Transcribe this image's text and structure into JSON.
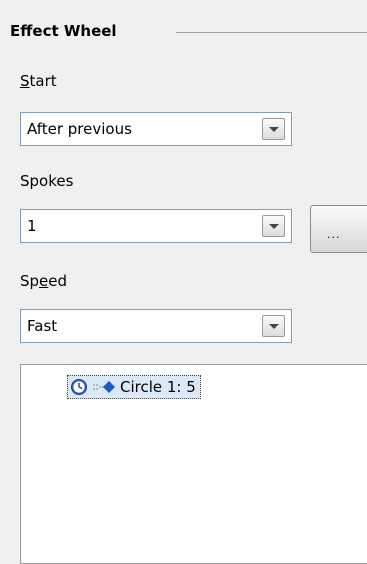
{
  "section": {
    "title": "Effect Wheel"
  },
  "start": {
    "label_mnemonic": "S",
    "label_rest": "tart",
    "value": "After previous"
  },
  "spokes": {
    "label": "Spokes",
    "value": "1",
    "more_button_label": "..."
  },
  "speed": {
    "label_before": "Sp",
    "label_mnemonic": "e",
    "label_after": "ed",
    "value": "Fast"
  },
  "effects": [
    {
      "trigger_icon": "clock-icon",
      "type_icon": "effect-entrance-icon",
      "label": "Circle 1: 5"
    }
  ]
}
